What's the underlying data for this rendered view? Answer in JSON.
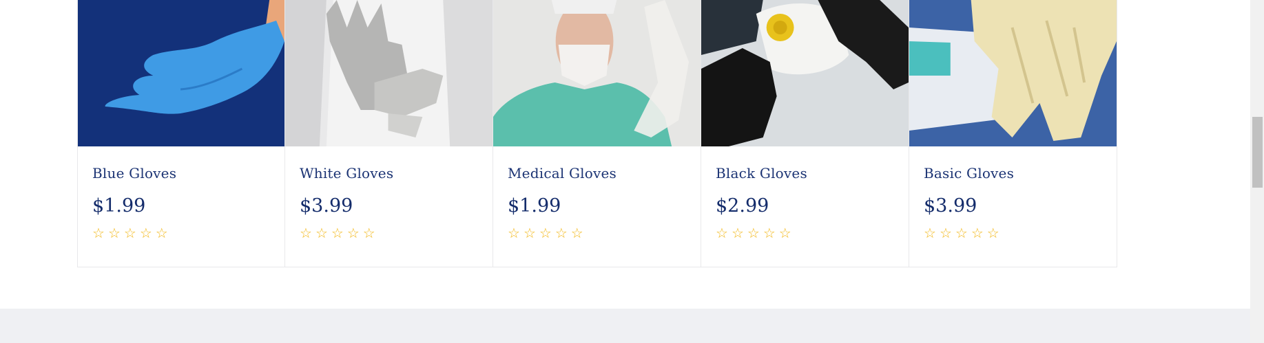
{
  "products": [
    {
      "name": "Blue Gloves",
      "price": "$1.99",
      "rating": 0,
      "image_label": "blue glove on blue background"
    },
    {
      "name": "White Gloves",
      "price": "$3.99",
      "rating": 0,
      "image_label": "person in white coat with white gloves"
    },
    {
      "name": "Medical Gloves",
      "price": "$1.99",
      "rating": 0,
      "image_label": "medical worker in mask putting on glove"
    },
    {
      "name": "Black Gloves",
      "price": "$2.99",
      "rating": 0,
      "image_label": "black gloves holding respirator mask"
    },
    {
      "name": "Basic Gloves",
      "price": "$3.99",
      "rating": 0,
      "image_label": "latex gloves on box"
    }
  ],
  "star_glyph": "☆",
  "colors": {
    "name_text": "#1c3474",
    "price_text": "#142c6b",
    "star": "#f2b81a",
    "footer_band": "#eff0f3"
  }
}
